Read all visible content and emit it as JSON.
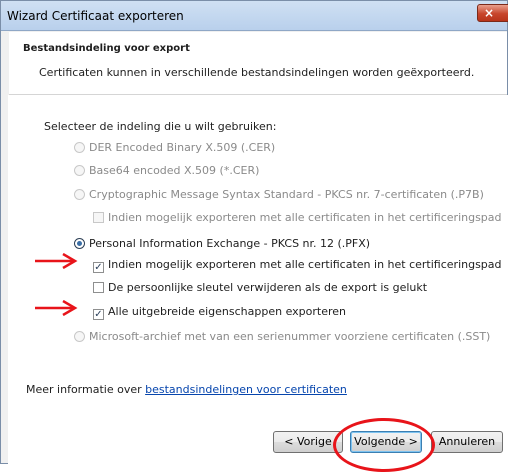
{
  "window": {
    "title": "Wizard Certificaat exporteren",
    "close_glyph": "×"
  },
  "header": {
    "title": "Bestandsindeling voor export",
    "description": "Certificaten kunnen in verschillende bestandsindelingen worden geëxporteerd."
  },
  "prompt": "Selecteer de indeling die u wilt gebruiken:",
  "options": {
    "der": "DER Encoded Binary X.509 (.CER)",
    "base64": "Base64 encoded X.509 (*.CER)",
    "p7b": "Cryptographic Message Syntax Standard - PKCS nr. 7-certificaten (.P7B)",
    "p7b_include_all": "Indien mogelijk exporteren met alle certificaten in het certificeringspad",
    "pfx": "Personal Information Exchange - PKCS nr. 12 (.PFX)",
    "pfx_include_all": "Indien mogelijk exporteren met alle certificaten in het certificeringspad",
    "pfx_delete_key": "De persoonlijke sleutel verwijderen als de export is gelukt",
    "pfx_export_props": "Alle uitgebreide eigenschappen exporteren",
    "sst": "Microsoft-archief met van een serienummer voorziene certificaten (.SST)"
  },
  "state": {
    "selected_format": "pfx",
    "pfx_include_all_checked": true,
    "pfx_delete_key_checked": false,
    "pfx_export_props_checked": true
  },
  "more_info": {
    "prefix": "Meer informatie over ",
    "link": "bestandsindelingen voor certificaten"
  },
  "buttons": {
    "back": "< Vorige",
    "next": "Volgende >",
    "cancel": "Annuleren"
  },
  "colors": {
    "annotation_red": "#e8141a",
    "link_blue": "#0645ad"
  }
}
